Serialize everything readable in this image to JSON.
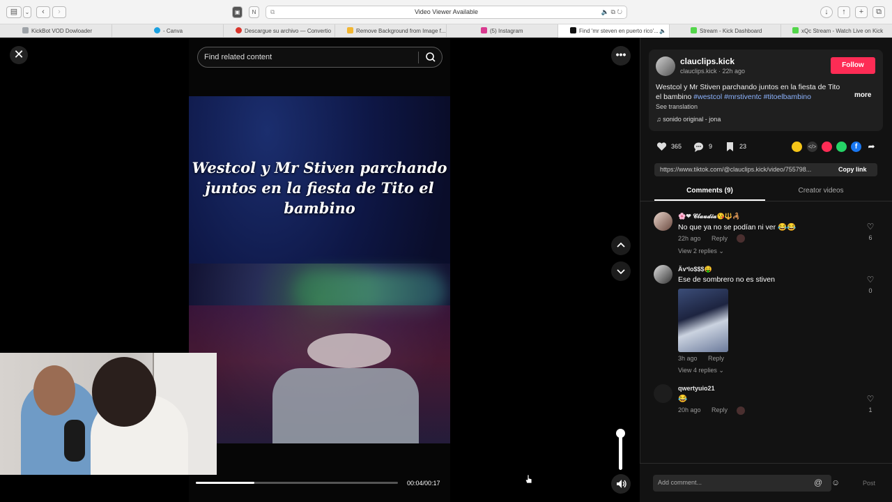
{
  "browser": {
    "address": "Video Viewer Available",
    "tabs": [
      {
        "label": "KickBot VOD Dowloader",
        "color": "#9ea3a8"
      },
      {
        "label": "- Canva",
        "color": "#1aa0e0"
      },
      {
        "label": "Descargue su archivo — Convertio",
        "color": "#d9342b"
      },
      {
        "label": "Remove Background from Image f...",
        "color": "#f2b632"
      },
      {
        "label": "(5) Instagram",
        "color": "#d93a8f"
      },
      {
        "label": "Find 'mr steven en puerto rico'...",
        "color": "#111111"
      },
      {
        "label": "Stream - Kick Dashboard",
        "color": "#53d64a"
      },
      {
        "label": "xQc Stream - Watch Live on Kick",
        "color": "#53d64a"
      }
    ]
  },
  "viewer": {
    "search_placeholder": "Find related content",
    "caption": "Westcol y Mr Stiven parchando juntos en la fiesta de Tito el bambino",
    "time": "00:04/00:17",
    "progress": 0.29,
    "volume": 1.0
  },
  "post": {
    "username": "clauclips.kick",
    "handle_time": "clauclips.kick · 22h ago",
    "follow_label": "Follow",
    "description_text": "Westcol y Mr Stiven parchando juntos en la fiesta de Tito el bambino ",
    "hashtags": "#westcol #mrstiventc #titoelbambino",
    "more_label": "more",
    "see_translation": "See translation",
    "music": "sonido original - jona",
    "likes": "365",
    "comments": "9",
    "saves": "23",
    "link": "https://www.tiktok.com/@clauclips.kick/video/755798...",
    "copy_link_label": "Copy link",
    "tab_comments": "Comments (9)",
    "tab_creator": "Creator videos"
  },
  "comments": [
    {
      "name": "🌸❤ 𝓒𝓵𝓪𝓾𝓭𝓲𝓪😘🔱🦂",
      "text": "No que ya no se podían ni ver 😂😂",
      "time": "22h ago",
      "reply": "Reply",
      "likes": "6",
      "replies": "View 2 replies ⌄"
    },
    {
      "name": "Äv³lo$$$🤑",
      "text": "Ese de sombrero no es stiven",
      "time": "3h ago",
      "reply": "Reply",
      "likes": "0",
      "replies": "View 4 replies ⌄"
    },
    {
      "name": "qwertyuio21",
      "text": "😂",
      "time": "20h ago",
      "reply": "Reply",
      "likes": "1"
    }
  ],
  "composer": {
    "placeholder": "Add comment...",
    "post_label": "Post"
  }
}
